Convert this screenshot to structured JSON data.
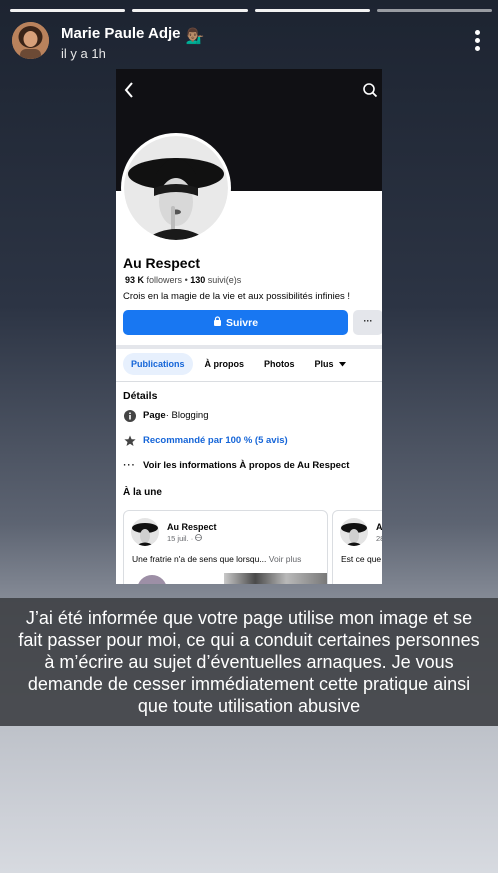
{
  "story": {
    "author": "Marie Paule Adje",
    "author_emoji": "💁🏽‍♂️",
    "time": "il y a 1h",
    "caption": "J’ai été informée que votre page utilise mon image et se fait passer pour moi, ce qui a conduit certaines personnes à m’écrire au sujet d’éventuelles arnaques. Je vous demande de cesser immédiatement cette pratique ainsi que toute utilisation abusive"
  },
  "icons": {
    "more": "more-vertical-icon",
    "back": "chevron-left-icon",
    "search": "search-icon",
    "lock": "lock-icon",
    "info": "info-icon",
    "star": "star-icon",
    "dots": "ellipsis-icon",
    "caret": "caret-down-icon"
  },
  "fb_page": {
    "name": "Au Respect",
    "followers_count": "93 K",
    "followers_label": "followers",
    "following_count": "130",
    "following_label": "suivi(e)s",
    "bio": "Crois en la magie de la vie et aux possibilités infinies !",
    "follow_label": "Suivre",
    "more_label": "···",
    "tabs": [
      "Publications",
      "À propos",
      "Photos",
      "Plus"
    ],
    "details_title": "Détails",
    "category_bold": "Page",
    "category_rest": " · Blogging",
    "recommended": "Recommandé par 100 % (5 avis)",
    "see_about": "Voir les informations À propos de Au Respect",
    "featured_title": "À la une",
    "cards": [
      {
        "name": "Au Respect",
        "date": "15 juil. ·",
        "text": "Une fratrie n'a de sens que lorsqu...",
        "see_more": "Voir plus"
      },
      {
        "name": "A",
        "date": "28",
        "text": "Est ce que"
      }
    ]
  },
  "colors": {
    "accent": "#1877f2",
    "active_tab_bg": "#e7f0fd",
    "active_tab_text": "#1565d8",
    "caption_bg": "#404246"
  }
}
